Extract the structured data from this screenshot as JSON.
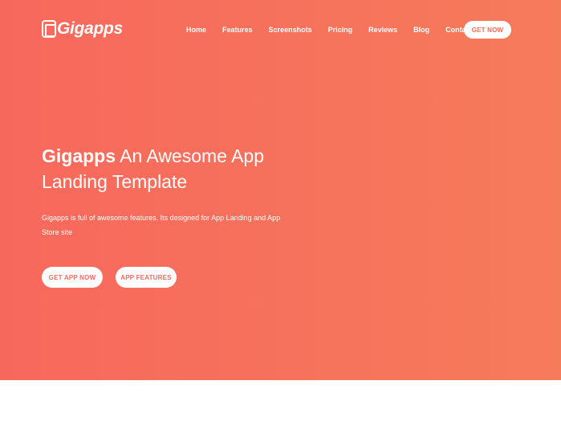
{
  "brand": {
    "logo_text": "Gigapps"
  },
  "nav": {
    "links": [
      "Home",
      "Features",
      "Screenshots",
      "Pricing",
      "Reviews",
      "Blog",
      "Contact"
    ],
    "cta": "GET NOW"
  },
  "hero": {
    "headline_brand": "Gigapps",
    "headline_rest": " An Awesome App Landing Template",
    "subtext": "Gigapps is full of awesome features. Its designed for App Landing and App Store site",
    "buttons": [
      "GET APP NOW",
      "APP FEATURES"
    ]
  },
  "colors": {
    "gradient_start": "#f7685c",
    "gradient_end": "#f67b5b",
    "button_text": "#f46a5e"
  }
}
